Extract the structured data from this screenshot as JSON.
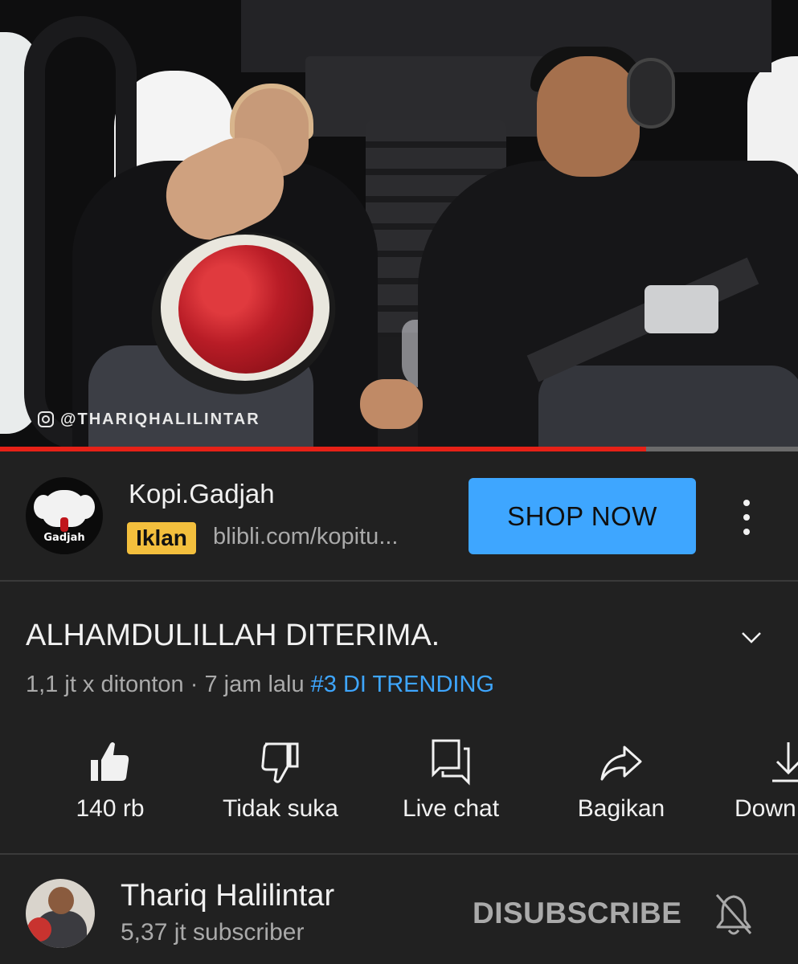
{
  "video": {
    "watermark": "@THARIQHALILINTAR",
    "progress_fraction": 0.81,
    "colors": {
      "progress": "#e62117",
      "track": "#6b6b6b"
    }
  },
  "ad": {
    "advertiser": "Kopi.Gadjah",
    "logo_text": "Gadjah",
    "badge": "Iklan",
    "url": "blibli.com/kopitu...",
    "cta": "SHOP NOW",
    "more_icon": "kebab-vertical-icon",
    "colors": {
      "cta": "#3ea6ff",
      "badge": "#f3bf3d"
    }
  },
  "video_info": {
    "title": "ALHAMDULILLAH DITERIMA.",
    "views": "1,1 jt x ditonton",
    "separator": " · ",
    "age": "7 jam lalu",
    "trending": "#3 DI TRENDING"
  },
  "actions": [
    {
      "icon": "thumbs-up-filled-icon",
      "label": "140 rb"
    },
    {
      "icon": "thumbs-down-icon",
      "label": "Tidak suka"
    },
    {
      "icon": "live-chat-icon",
      "label": "Live chat"
    },
    {
      "icon": "share-icon",
      "label": "Bagikan"
    },
    {
      "icon": "download-icon",
      "label": "Down"
    }
  ],
  "channel": {
    "name": "Thariq Halilintar",
    "subscribers": "5,37 jt subscriber",
    "subscribe_button": "DISUBSCRIBE",
    "bell_icon": "bell-off-icon"
  }
}
